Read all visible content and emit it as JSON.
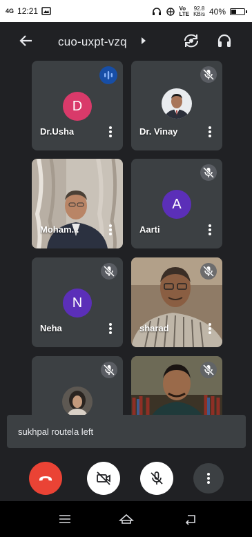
{
  "status_bar": {
    "network": "4G",
    "time": "12:21",
    "net_speed": "92.8",
    "net_speed_unit": "KB/s",
    "battery": "40%",
    "battery_level": 0.4
  },
  "header": {
    "meeting_code": "cuo-uxpt-vzq",
    "icons": [
      "back-arrow-icon",
      "chevron-right-icon",
      "switch-camera-icon",
      "headphones-icon"
    ]
  },
  "participants": [
    {
      "name": "Dr.Usha",
      "initial": "D",
      "avatar_color": "#d93a6a",
      "state": "speaking"
    },
    {
      "name": "Dr. Vinay",
      "state": "muted",
      "avatar": "photo"
    },
    {
      "name": "Moham...",
      "state": "video"
    },
    {
      "name": "Aarti",
      "initial": "A",
      "avatar_color": "#5b2fb8",
      "state": "muted"
    },
    {
      "name": "Neha",
      "initial": "N",
      "avatar_color": "#5b2fb8",
      "state": "muted"
    },
    {
      "name": "sharad",
      "state": "muted-video"
    },
    {
      "name": "",
      "state": "muted",
      "avatar": "photo"
    },
    {
      "name": "",
      "state": "muted-video"
    }
  ],
  "toast": {
    "text": "sukhpal routela left"
  },
  "controls": {
    "end_call_color": "#ea4335",
    "buttons": [
      "end-call-icon",
      "camera-off-icon",
      "mic-off-icon",
      "more-options-icon"
    ]
  },
  "nav": {
    "buttons": [
      "menu-icon",
      "home-icon",
      "back-icon"
    ]
  }
}
